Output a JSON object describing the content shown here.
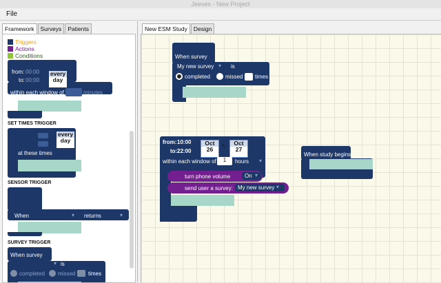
{
  "window": {
    "title": "Jeeves - New Project"
  },
  "menu": {
    "file": "File"
  },
  "left_tabs": [
    "Framework",
    "Surveys",
    "Patients"
  ],
  "legend": [
    {
      "label": "Triggers",
      "color": "#f0a020"
    },
    {
      "label": "Actions",
      "color": "#741f8f"
    },
    {
      "label": "Conditions",
      "color": "#8fc43a"
    }
  ],
  "palette": {
    "first": {
      "from_label": "from:",
      "from_value": "00:00",
      "to_label": "to:",
      "to_value": "00:00",
      "day": [
        "every",
        "day"
      ],
      "window_label": "within each window of",
      "window_unit": "minutes"
    },
    "set_times": {
      "header": "SET TIMES TRIGGER",
      "day": [
        "every",
        "day"
      ],
      "at_label": "at these times"
    },
    "sensor": {
      "header": "SENSOR TRIGGER",
      "when": "When",
      "returns": "returns"
    },
    "survey": {
      "header": "SURVEY TRIGGER",
      "when": "When survey",
      "is": "is",
      "completed": "completed",
      "missed": "missed",
      "times": "times"
    }
  },
  "right_tabs": [
    "New ESM Study",
    "Design"
  ],
  "workspace": {
    "survey_block": {
      "title": "When survey",
      "survey": "My new survey",
      "is": "is",
      "completed": "completed",
      "missed": "missed",
      "times": "times",
      "completed_selected": true
    },
    "time_block": {
      "from_label": "from:",
      "from_value": "10:00",
      "to_label": "to:",
      "to_value": "22:00",
      "date1": [
        "Oct",
        "26"
      ],
      "date2": [
        "Oct",
        "27"
      ],
      "window_label": "within each window of",
      "window_value": "1",
      "window_unit": "hours"
    },
    "action_volume": {
      "label": "turn phone volume",
      "value": "On"
    },
    "action_survey": {
      "label": "send user a survey:",
      "value": "My new survey"
    },
    "study_block": {
      "title": "When study begins"
    }
  }
}
